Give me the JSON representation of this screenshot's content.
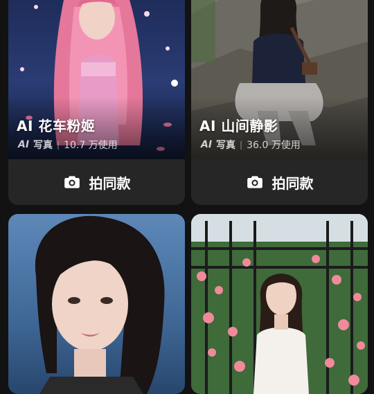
{
  "cards": [
    {
      "title": "AI 花车粉姬",
      "ai_badge": "AI",
      "tag": "写真",
      "separator": "|",
      "usage": "10.7 万使用",
      "action_label": "拍同款",
      "action_icon": "camera-icon"
    },
    {
      "title": "AI 山间静影",
      "ai_badge": "AI",
      "tag": "写真",
      "separator": "|",
      "usage": "36.0 万使用",
      "action_label": "拍同款",
      "action_icon": "camera-icon"
    },
    {
      "title": "",
      "usage": ""
    },
    {
      "title": "",
      "usage": ""
    }
  ]
}
